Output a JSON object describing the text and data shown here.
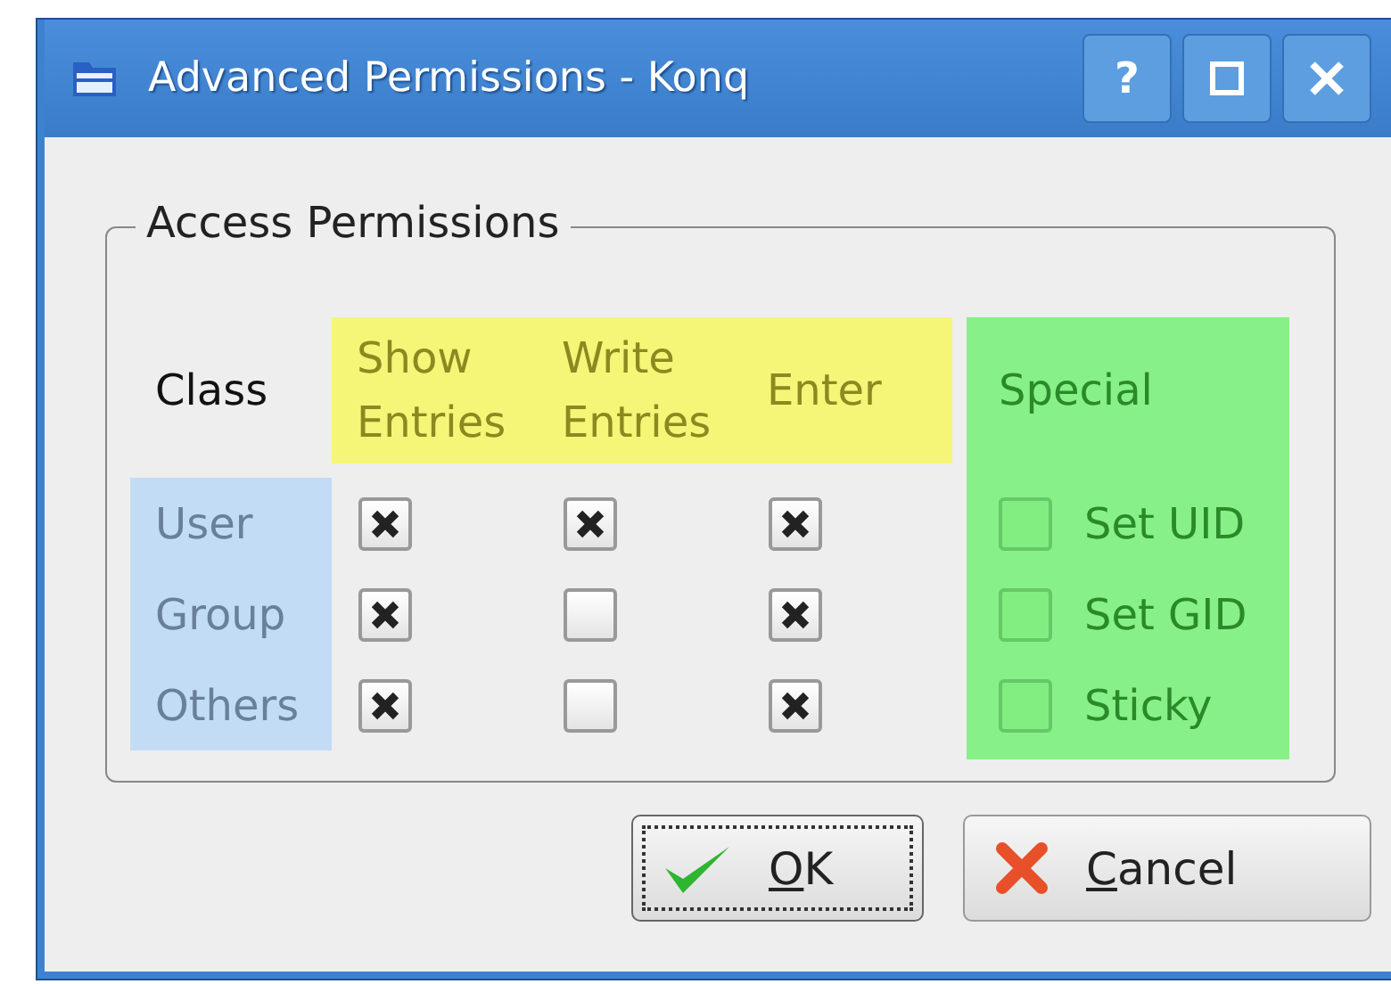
{
  "window": {
    "title": "Advanced Permissions - Konq",
    "help": "?"
  },
  "group_title": "Access Permissions",
  "class_header": "Class",
  "permission_headers": [
    {
      "lines": [
        "Show",
        "Entries"
      ]
    },
    {
      "lines": [
        "Write",
        "Entries"
      ]
    },
    {
      "lines": [
        "Enter"
      ]
    }
  ],
  "special_header": "Special",
  "rows": [
    {
      "class": "User",
      "permissions": [
        {
          "checked": true
        },
        {
          "checked": true
        },
        {
          "checked": true
        }
      ]
    },
    {
      "class": "Group",
      "permissions": [
        {
          "checked": true
        },
        {
          "checked": false
        },
        {
          "checked": true
        }
      ]
    },
    {
      "class": "Others",
      "permissions": [
        {
          "checked": true
        },
        {
          "checked": false
        },
        {
          "checked": true
        }
      ]
    }
  ],
  "special": [
    {
      "label": "Set UID",
      "checked": false
    },
    {
      "label": "Set GID",
      "checked": false
    },
    {
      "label": "Sticky",
      "checked": false
    }
  ],
  "buttons": [
    {
      "kind": "ok",
      "mnemonic": "O",
      "rest": "K",
      "focused": true
    },
    {
      "kind": "cancel",
      "mnemonic": "C",
      "rest": "ancel",
      "focused": false
    }
  ]
}
